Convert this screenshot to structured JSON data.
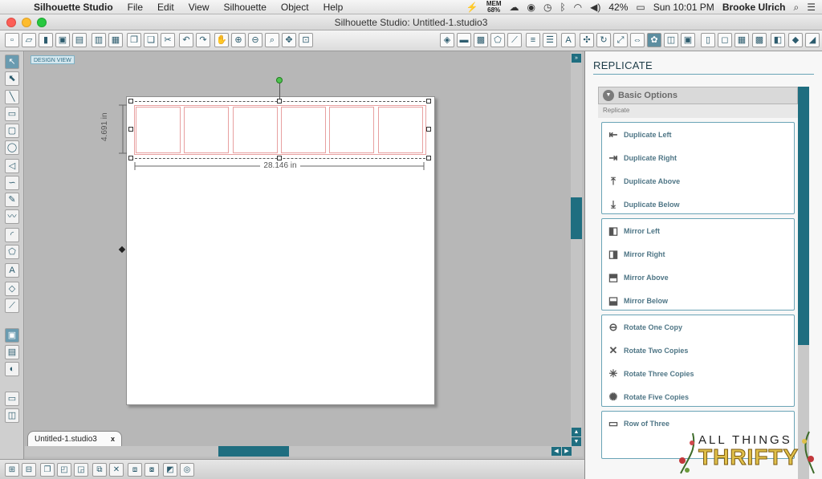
{
  "menubar": {
    "app_name": "Silhouette Studio",
    "items": [
      "File",
      "Edit",
      "View",
      "Silhouette",
      "Object",
      "Help"
    ],
    "mem_label": "MEM",
    "mem_value": "68%",
    "battery": "42%",
    "clock": "Sun 10:01 PM",
    "user": "Brooke Ulrich"
  },
  "window": {
    "title": "Silhouette Studio: Untitled-1.studio3"
  },
  "canvas": {
    "design_view_label": "DESIGN VIEW",
    "width_label": "28.146 in",
    "height_label": "4.691 in",
    "document_tab": "Untitled-1.studio3",
    "tab_close": "x"
  },
  "panel": {
    "title": "REPLICATE",
    "section_title": "Basic Options",
    "subsection_label": "Replicate",
    "groups": [
      {
        "items": [
          {
            "label": "Duplicate Left",
            "icon": "duplicate-left-icon"
          },
          {
            "label": "Duplicate Right",
            "icon": "duplicate-right-icon"
          },
          {
            "label": "Duplicate Above",
            "icon": "duplicate-above-icon"
          },
          {
            "label": "Duplicate Below",
            "icon": "duplicate-below-icon"
          }
        ]
      },
      {
        "items": [
          {
            "label": "Mirror Left",
            "icon": "mirror-left-icon"
          },
          {
            "label": "Mirror Right",
            "icon": "mirror-right-icon"
          },
          {
            "label": "Mirror Above",
            "icon": "mirror-above-icon"
          },
          {
            "label": "Mirror Below",
            "icon": "mirror-below-icon"
          }
        ]
      },
      {
        "items": [
          {
            "label": "Rotate One Copy",
            "icon": "rotate-one-copy-icon"
          },
          {
            "label": "Rotate Two Copies",
            "icon": "rotate-two-copies-icon"
          },
          {
            "label": "Rotate Three Copies",
            "icon": "rotate-three-copies-icon"
          },
          {
            "label": "Rotate Five Copies",
            "icon": "rotate-five-copies-icon"
          }
        ]
      },
      {
        "items": [
          {
            "label": "Row of Three",
            "icon": "row-of-three-icon"
          }
        ]
      }
    ]
  },
  "watermark": {
    "line1": "ALL THINGS",
    "line2": "THRIFTY"
  },
  "colors": {
    "accent": "#1f6e80",
    "cut_line": "#e8a0a0",
    "rotate_handle": "#4ec24e"
  }
}
